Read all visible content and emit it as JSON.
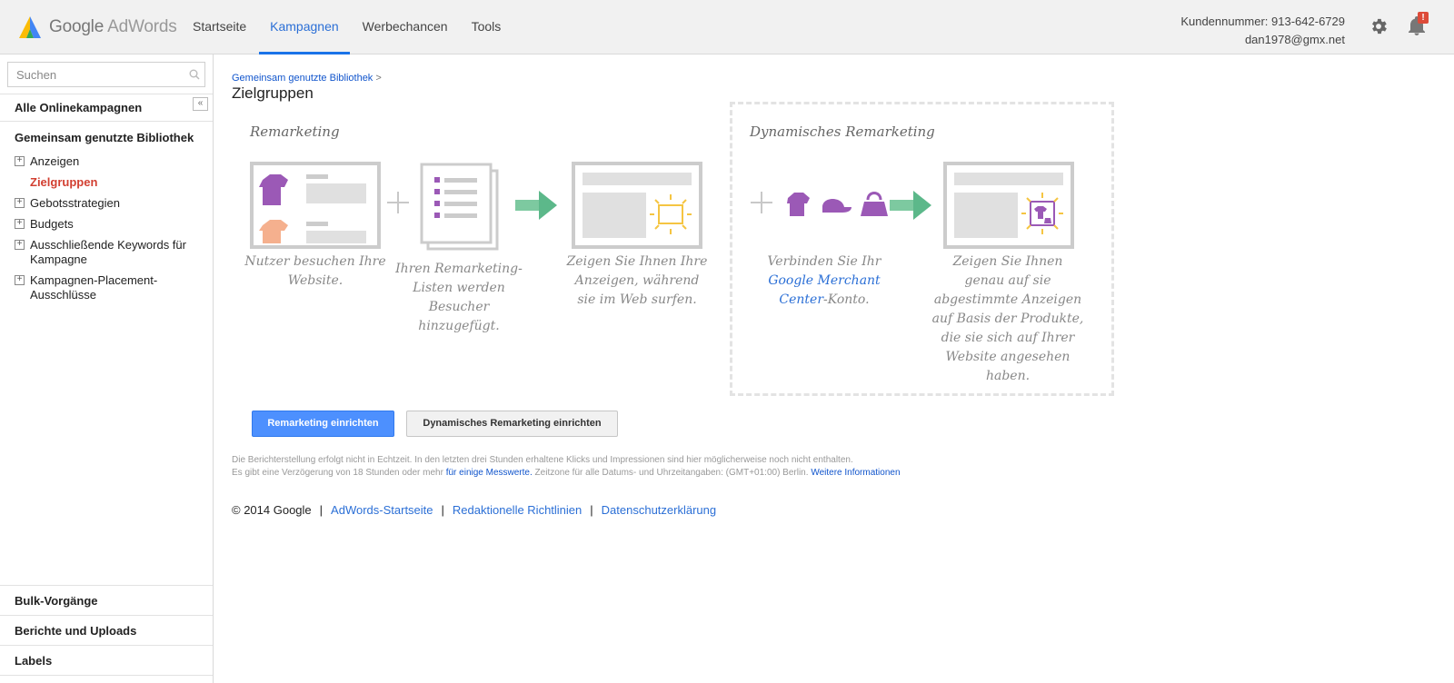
{
  "header": {
    "logo_google": "Google",
    "logo_adwords": "AdWords",
    "nav": [
      "Startseite",
      "Kampagnen",
      "Werbechancen",
      "Tools"
    ],
    "active_nav": "Kampagnen",
    "customer_number": "Kundennummer: 913-642-6729",
    "email": "dan1978@gmx.net",
    "notification_badge": "!",
    "accent_color": "#2b6fd6"
  },
  "sidebar": {
    "search_placeholder": "Suchen",
    "all_campaigns": "Alle Onlinekampagnen",
    "collapse_symbol": "«",
    "library_title": "Gemeinsam genutzte Bibliothek",
    "items": [
      {
        "label": "Anzeigen",
        "expandable": true
      },
      {
        "label": "Zielgruppen",
        "expandable": false,
        "active": true
      },
      {
        "label": "Gebotsstrategien",
        "expandable": true
      },
      {
        "label": "Budgets",
        "expandable": true
      },
      {
        "label": "Ausschließende Keywords für Kampagne",
        "expandable": true
      },
      {
        "label": "Kampagnen-Placement-Ausschlüsse",
        "expandable": true
      }
    ],
    "bottom": [
      "Bulk-Vorgänge",
      "Berichte und Uploads",
      "Labels"
    ]
  },
  "main": {
    "breadcrumb": "Gemeinsam genutzte Bibliothek",
    "breadcrumb_sep": ">",
    "title": "Zielgruppen",
    "remarketing": {
      "title": "Remarketing",
      "step1": "Nutzer besuchen Ihre Website.",
      "step2": "Ihren Remarketing-Listen werden Besucher hinzugefügt.",
      "step3": "Zeigen Sie Ihnen Ihre Anzeigen, während sie im Web surfen."
    },
    "dynamic": {
      "title": "Dynamisches Remarketing",
      "step1_pre": "Verbinden Sie Ihr",
      "step1_link": "Google Merchant Center",
      "step1_post": "-Konto.",
      "step2": "Zeigen Sie Ihnen genau auf sie abgestimmte Anzeigen auf Basis der Produkte, die sie sich auf Ihrer Website angesehen haben."
    },
    "btn_remarketing": "Remarketing einrichten",
    "btn_dynamic": "Dynamisches Remarketing einrichten",
    "notice_line1": "Die Berichterstellung erfolgt nicht in Echtzeit. In den letzten drei Stunden erhaltene Klicks und Impressionen sind hier möglicherweise noch nicht enthalten.",
    "notice_line2_pre": "Es gibt eine Verzögerung von 18 Stunden oder mehr",
    "notice_line2_link": "für einige Messwerte.",
    "notice_line2_mid": "Zeitzone für alle Datums- und Uhrzeitangaben: (GMT+01:00) Berlin.",
    "notice_line2_link2": "Weitere Informationen",
    "footer": {
      "copyright": "© 2014 Google",
      "links": [
        "AdWords-Startseite",
        "Redaktionelle Richtlinien",
        "Datenschutzerklärung"
      ]
    }
  }
}
